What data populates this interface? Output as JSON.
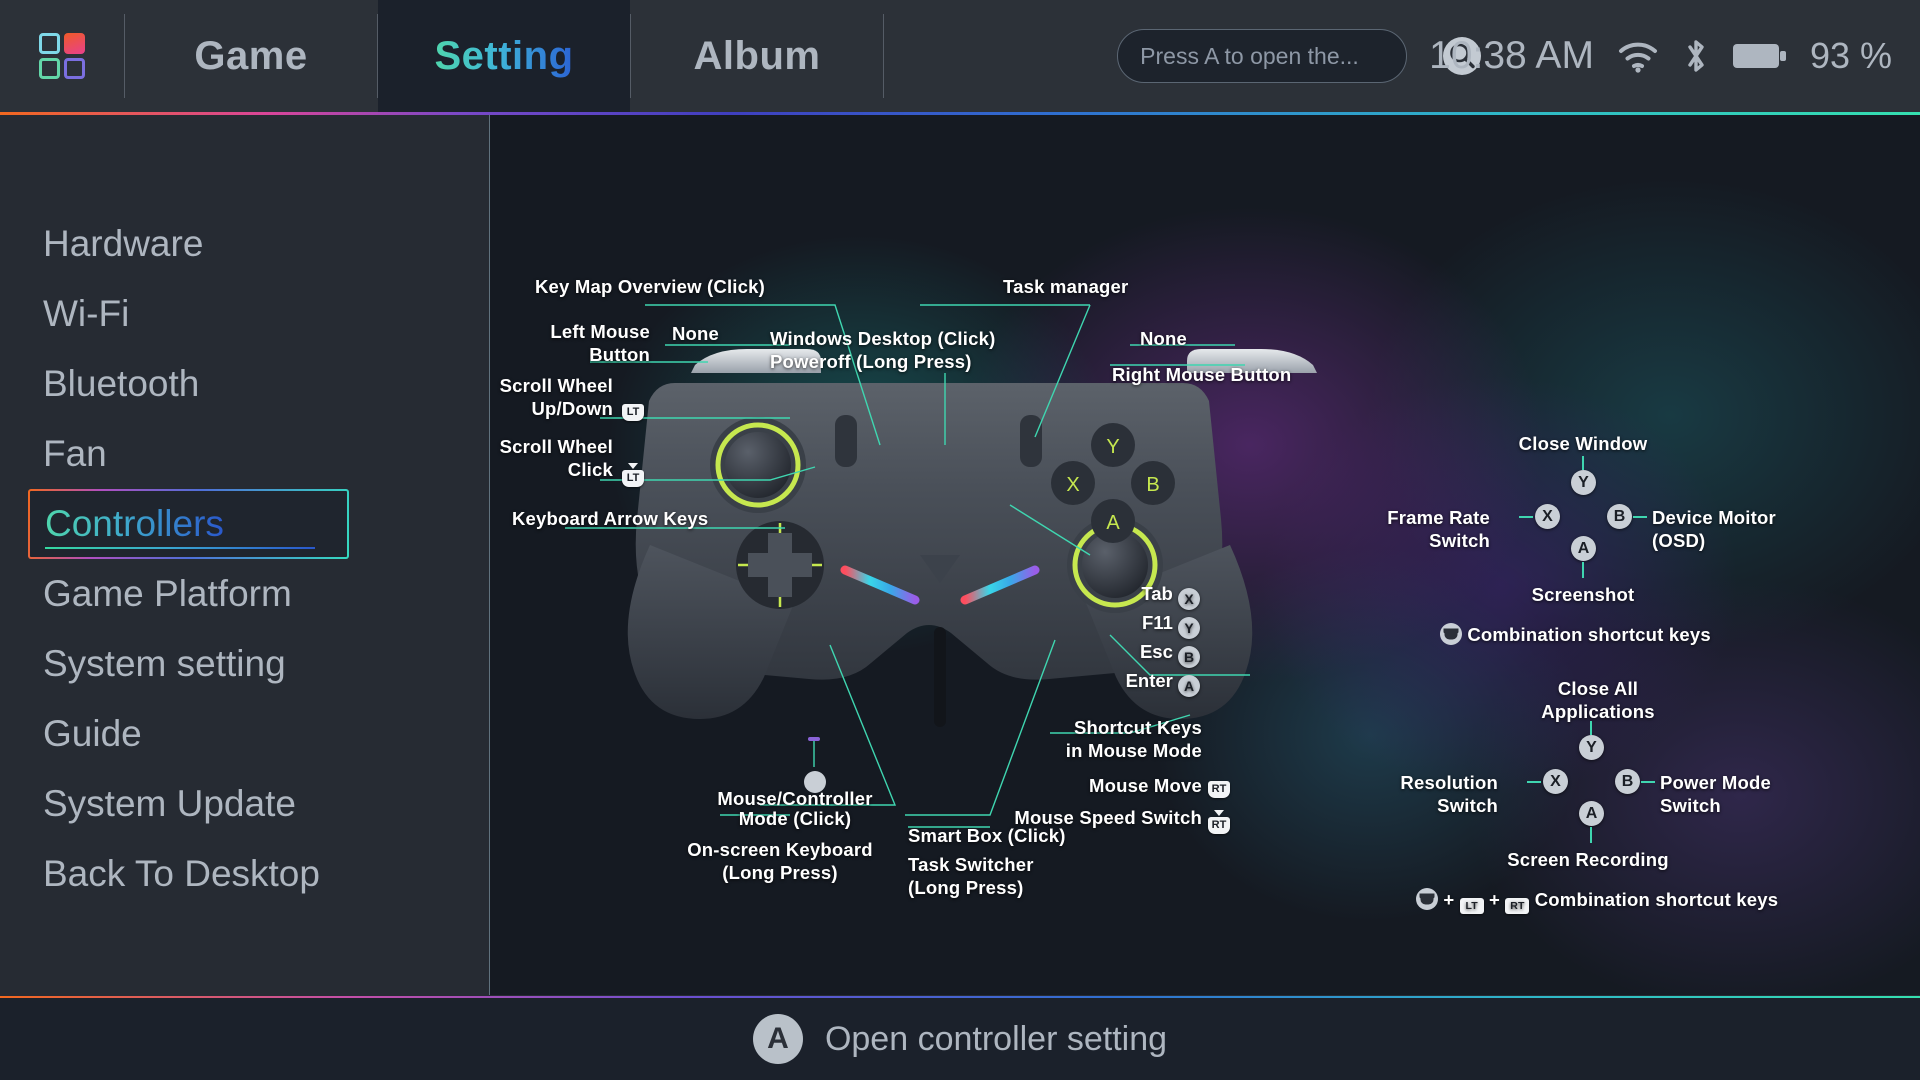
{
  "header": {
    "logo_icon": "app-grid-logo",
    "tabs": [
      {
        "label": "Game",
        "active": false
      },
      {
        "label": "Setting",
        "active": true
      },
      {
        "label": "Album",
        "active": false
      }
    ],
    "search": {
      "placeholder": "Press A to open the...",
      "value": "",
      "icon": "search-icon"
    },
    "clock": "10:38 AM",
    "wifi_icon": "wifi-icon",
    "bluetooth_icon": "bluetooth-icon",
    "battery_icon": "battery-icon",
    "battery_percent": "93 %"
  },
  "sidebar": {
    "items": [
      {
        "label": "Hardware",
        "selected": false
      },
      {
        "label": "Wi-Fi",
        "selected": false
      },
      {
        "label": "Bluetooth",
        "selected": false
      },
      {
        "label": "Fan",
        "selected": false
      },
      {
        "label": "Controllers",
        "selected": true
      },
      {
        "label": "Game Platform",
        "selected": false
      },
      {
        "label": "System setting",
        "selected": false
      },
      {
        "label": "Guide",
        "selected": false
      },
      {
        "label": "System Update",
        "selected": false
      },
      {
        "label": "Back To Desktop",
        "selected": false
      }
    ]
  },
  "diagram": {
    "callouts": {
      "key_map_overview": "Key Map Overview (Click)",
      "task_manager": "Task manager",
      "windows_desktop_l1": "Windows Desktop (Click)",
      "windows_desktop_l2": "Poweroff (Long Press)",
      "left_mouse_l1": "Left Mouse",
      "left_mouse_l2": "Button",
      "none_left": "None",
      "none_right": "None",
      "right_mouse_button": "Right Mouse Button",
      "scroll_wheel_ud_l1": "Scroll Wheel",
      "scroll_wheel_ud_l2": "Up/Down",
      "scroll_wheel_click_l1": "Scroll Wheel",
      "scroll_wheel_click_l2": "Click",
      "keyboard_arrow_keys": "Keyboard Arrow Keys",
      "mouse_controller_l1": "Mouse/Controller",
      "mouse_controller_l2": "Mode (Click)",
      "onscreen_keyboard_l1": "On-screen Keyboard",
      "onscreen_keyboard_l2": "(Long Press)",
      "smart_box": "Smart Box (Click)",
      "task_switcher_l1": "Task Switcher",
      "task_switcher_l2": "(Long Press)",
      "mouse_move": "Mouse Move",
      "mouse_speed_switch": "Mouse Speed Switch",
      "shortcut_keys_l1": "Shortcut Keys",
      "shortcut_keys_l2": "in Mouse Mode"
    },
    "trigger_icons": {
      "lt": "LT",
      "rt": "RT",
      "lt_press": "LT",
      "rt_press": "RT"
    },
    "mouse_mode_keys": [
      {
        "label": "Tab",
        "button": "X"
      },
      {
        "label": "F11",
        "button": "Y"
      },
      {
        "label": "Esc",
        "button": "B"
      },
      {
        "label": "Enter",
        "button": "A"
      }
    ],
    "shortcut_cluster_1": {
      "top": {
        "button": "Y",
        "label": "Close Window"
      },
      "left": {
        "button": "X",
        "label_l1": "Frame Rate",
        "label_l2": "Switch"
      },
      "right": {
        "button": "B",
        "label_l1": "Device Moitor",
        "label_l2": "(OSD)"
      },
      "bottom": {
        "button": "A",
        "label": "Screenshot"
      },
      "legend": "Combination shortcut keys"
    },
    "shortcut_cluster_2": {
      "top": {
        "button": "Y",
        "label_l1": "Close All",
        "label_l2": "Applications"
      },
      "left": {
        "button": "X",
        "label_l1": "Resolution",
        "label_l2": "Switch"
      },
      "right": {
        "button": "B",
        "label_l1": "Power Mode",
        "label_l2": "Switch"
      },
      "bottom": {
        "button": "A",
        "label": "Screen Recording"
      },
      "legend": "Combination shortcut keys",
      "legend_plus_1": "+",
      "legend_plus_2": "+"
    }
  },
  "footer": {
    "button": "A",
    "hint": "Open controller setting"
  }
}
